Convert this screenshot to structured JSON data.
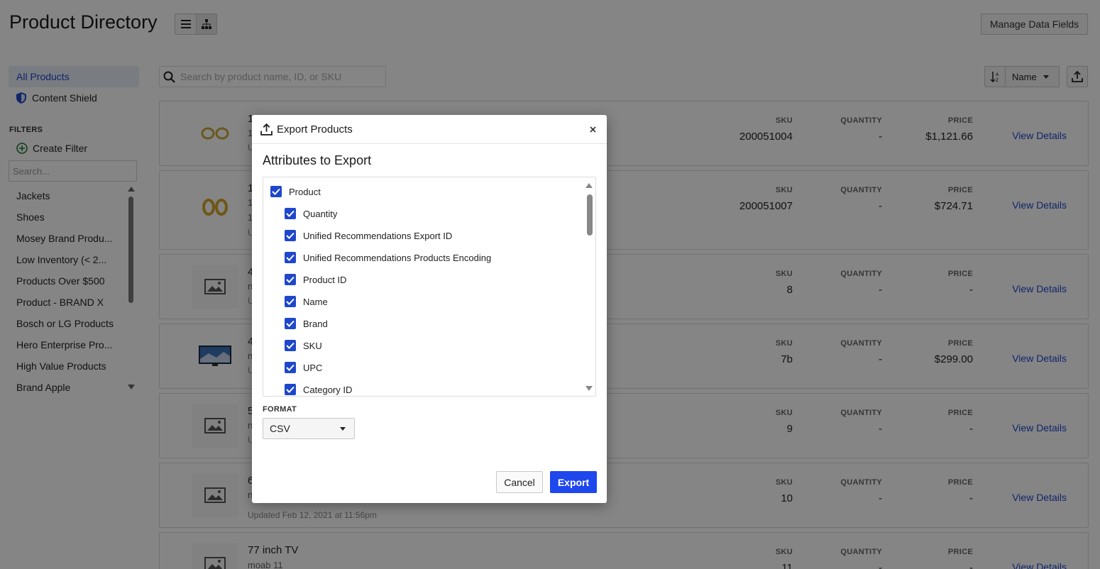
{
  "header": {
    "title": "Product Directory",
    "manage_button": "Manage Data Fields"
  },
  "sidebar": {
    "links": [
      {
        "label": "All Products",
        "active": true
      },
      {
        "label": "Content Shield",
        "icon": "shield-icon"
      }
    ],
    "filters_label": "FILTERS",
    "create_filter": "Create Filter",
    "search_placeholder": "Search...",
    "filters": [
      "Jackets",
      "Shoes",
      "Mosey Brand Produ...",
      "Low Inventory (< 2...",
      "Products Over $500",
      "Product - BRAND X",
      "Bosch or LG Products",
      "Hero Enterprise Pro...",
      "High Value Products",
      "Brand Apple"
    ]
  },
  "toolbar": {
    "search_placeholder": "Search by product name, ID, or SKU",
    "sort_field": "Name"
  },
  "columns": {
    "sku": "SKU",
    "quantity": "QUANTITY",
    "price": "PRICE"
  },
  "view_details_label": "View Details",
  "products": [
    {
      "name": "1",
      "id": "1",
      "updated": "U",
      "sku": "200051004",
      "quantity": "-",
      "price": "$1,121.66",
      "thumb": "earrings-image"
    },
    {
      "name": "1",
      "id": "1",
      "id2": "1",
      "updated": "U",
      "sku": "200051007",
      "quantity": "-",
      "price": "$724.71",
      "thumb": "hoop-earrings-image"
    },
    {
      "name": "4",
      "id": "n",
      "updated": "U",
      "sku": "8",
      "quantity": "-",
      "price": "-",
      "thumb": "image-placeholder-icon"
    },
    {
      "name": "4",
      "id": "n",
      "updated": "U",
      "sku": "7b",
      "quantity": "-",
      "price": "$299.00",
      "thumb": "tv-image"
    },
    {
      "name": "5",
      "id": "n",
      "updated": "U",
      "sku": "9",
      "quantity": "-",
      "price": "-",
      "thumb": "image-placeholder-icon"
    },
    {
      "name": "6",
      "id": "n",
      "updated": "Updated Feb 12, 2021 at 11:56pm",
      "sku": "10",
      "quantity": "-",
      "price": "-",
      "thumb": "image-placeholder-icon"
    },
    {
      "name": "77 inch TV",
      "id": "moab 11",
      "updated": "",
      "sku": "11",
      "quantity": "-",
      "price": "-",
      "thumb": "image-placeholder-icon"
    }
  ],
  "modal": {
    "title": "Export Products",
    "section_title": "Attributes to Export",
    "attributes": [
      {
        "label": "Product",
        "checked": true,
        "level": 0
      },
      {
        "label": "Quantity",
        "checked": true,
        "level": 1
      },
      {
        "label": "Unified Recommendations Export ID",
        "checked": true,
        "level": 1
      },
      {
        "label": "Unified Recommendations Products Encoding",
        "checked": true,
        "level": 1
      },
      {
        "label": "Product ID",
        "checked": true,
        "level": 1
      },
      {
        "label": "Name",
        "checked": true,
        "level": 1
      },
      {
        "label": "Brand",
        "checked": true,
        "level": 1
      },
      {
        "label": "SKU",
        "checked": true,
        "level": 1
      },
      {
        "label": "UPC",
        "checked": true,
        "level": 1
      },
      {
        "label": "Category ID",
        "checked": true,
        "level": 1
      }
    ],
    "format_label": "FORMAT",
    "format_value": "CSV",
    "cancel": "Cancel",
    "export": "Export"
  },
  "colors": {
    "accent": "#1f47ee",
    "link": "#1f47cc"
  }
}
